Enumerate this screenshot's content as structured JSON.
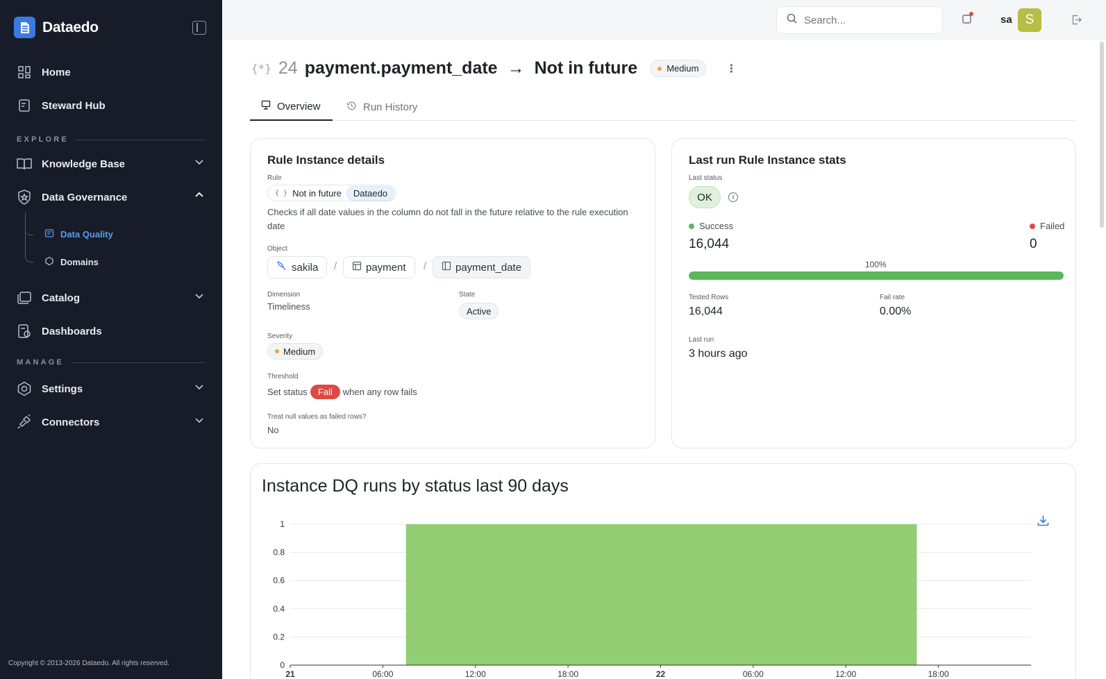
{
  "app": {
    "name": "Dataedo"
  },
  "sidebar": {
    "home": "Home",
    "steward_hub": "Steward Hub",
    "explore_label": "EXPLORE",
    "knowledge_base": "Knowledge Base",
    "data_governance": "Data Governance",
    "data_quality": "Data Quality",
    "domains": "Domains",
    "catalog": "Catalog",
    "dashboards": "Dashboards",
    "manage_label": "MANAGE",
    "settings": "Settings",
    "connectors": "Connectors",
    "copyright": "Copyright © 2013-2026 Dataedo. All rights reserved."
  },
  "topbar": {
    "search_placeholder": "Search...",
    "user": "sa",
    "avatar_letter": "S"
  },
  "header": {
    "icon": "{*}",
    "number": "24",
    "column": "payment.payment_date",
    "arrow": "→",
    "rule": "Not in future",
    "severity": "Medium",
    "kebab": "⋮"
  },
  "tabs": [
    {
      "label": "Overview",
      "active": true
    },
    {
      "label": "Run History",
      "active": false
    }
  ],
  "details": {
    "title": "Rule Instance details",
    "rule_label": "Rule",
    "rule_icon": "{ }",
    "rule_name": "Not in future",
    "rule_source": "Dataedo",
    "description": "Checks if all date values in the column do not fall in the future relative to the rule execution date",
    "object_label": "Object",
    "object_db": "sakila",
    "object_table": "payment",
    "object_column": "payment_date",
    "object_sep": "/",
    "dimension_label": "Dimension",
    "dimension": "Timeliness",
    "state_label": "State",
    "state": "Active",
    "severity_label": "Severity",
    "severity": "Medium",
    "threshold_label": "Threshold",
    "threshold_prefix": "Set status",
    "threshold_status": "Fail",
    "threshold_suffix": "when any row fails",
    "null_label": "Treat null values as failed rows?",
    "null_value": "No"
  },
  "stats": {
    "title": "Last run Rule Instance stats",
    "last_status_label": "Last status",
    "last_status": "OK",
    "info": "i",
    "success_label": "Success",
    "success_value": "16,044",
    "failed_label": "Failed",
    "failed_value": "0",
    "percent": "100%",
    "success_fraction": 1.0,
    "tested_rows_label": "Tested Rows",
    "tested_rows": "16,044",
    "fail_rate_label": "Fail rate",
    "fail_rate": "0.00%",
    "last_run_label": "Last run",
    "last_run": "3 hours ago"
  },
  "colors": {
    "accent": "#3b7ae0",
    "success": "#5cb85c",
    "fail": "#dd4a44",
    "bar": "#92cd73",
    "severity_medium": "#f2a33a"
  },
  "chart_data": {
    "type": "bar",
    "title": "Instance DQ runs by status last 90 days",
    "x_ticks": [
      "21",
      "06:00",
      "12:00",
      "18:00",
      "22",
      "06:00",
      "12:00",
      "18:00"
    ],
    "x_tick_hours": [
      0,
      6,
      12,
      18,
      24,
      30,
      36,
      42
    ],
    "x_range_hours": [
      0,
      48
    ],
    "y_ticks": [
      "0",
      "0.2",
      "0.4",
      "0.6",
      "0.8",
      "1"
    ],
    "ylim": [
      0,
      1
    ],
    "grid": true,
    "series": [
      {
        "start_hour": 7.5,
        "end_hour": 40.6,
        "value": 1
      }
    ]
  }
}
